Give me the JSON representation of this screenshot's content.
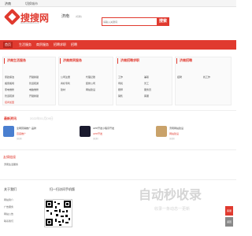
{
  "topbar": {
    "city": "济南",
    "location": "切换城市"
  },
  "logo": {
    "text": "搜搜网",
    "url": "www.sousou.com"
  },
  "city": {
    "name": "济南",
    "switch": "[切换]"
  },
  "search": {
    "placeholder": "请输入关键词",
    "button": "搜索"
  },
  "nav": {
    "items": [
      "首页",
      "生活服务",
      "商贸服务",
      "招聘求职",
      "招聘"
    ]
  },
  "sections": [
    {
      "title": "济南生活服务",
      "links": [
        "家政保洁",
        "开锁换锁",
        "搬家搬场",
        "管道疏通",
        "家电维修",
        "电脑维修",
        "管道疏通",
        "开锁换锁",
        "招商加盟"
      ]
    },
    {
      "title": "济南商贸服务",
      "links": [
        "公司注册",
        "代理记账",
        "商标专利",
        "装修公司",
        "建材",
        "网站建设"
      ]
    },
    {
      "title": "济南招聘求职",
      "links": [
        "工作",
        "兼职",
        "司机",
        "普工",
        "厨师",
        "服务员",
        "销售",
        "客服"
      ]
    },
    {
      "title": "济南招聘",
      "links": [
        "招聘",
        "找工作"
      ]
    }
  ],
  "news": {
    "title": "最新资讯",
    "subtitle": "2022年01月09日",
    "items": [
      {
        "title": "全网营销推广·品牌",
        "tag": "百度推广",
        "sub": "[来源]"
      },
      {
        "title": "APP开发小程序开发",
        "tag": "APP开发",
        "sub": "[来源]"
      },
      {
        "title": "济南网站建设",
        "tag": "网站建设",
        "sub": "[来源]"
      }
    ]
  },
  "friend": {
    "title": "友情链接",
    "link": "济南生活服务"
  },
  "about": {
    "title": "关于我们",
    "links": [
      "网站简介",
      "广告服务",
      "网站公告",
      "联系我们"
    ]
  },
  "qr": {
    "title": "扫一扫访问手机版"
  },
  "watermark": {
    "text": "自动秒收录",
    "sub": "收录一条动态一更新"
  },
  "right": {
    "items": [
      "客服",
      "返回"
    ]
  }
}
